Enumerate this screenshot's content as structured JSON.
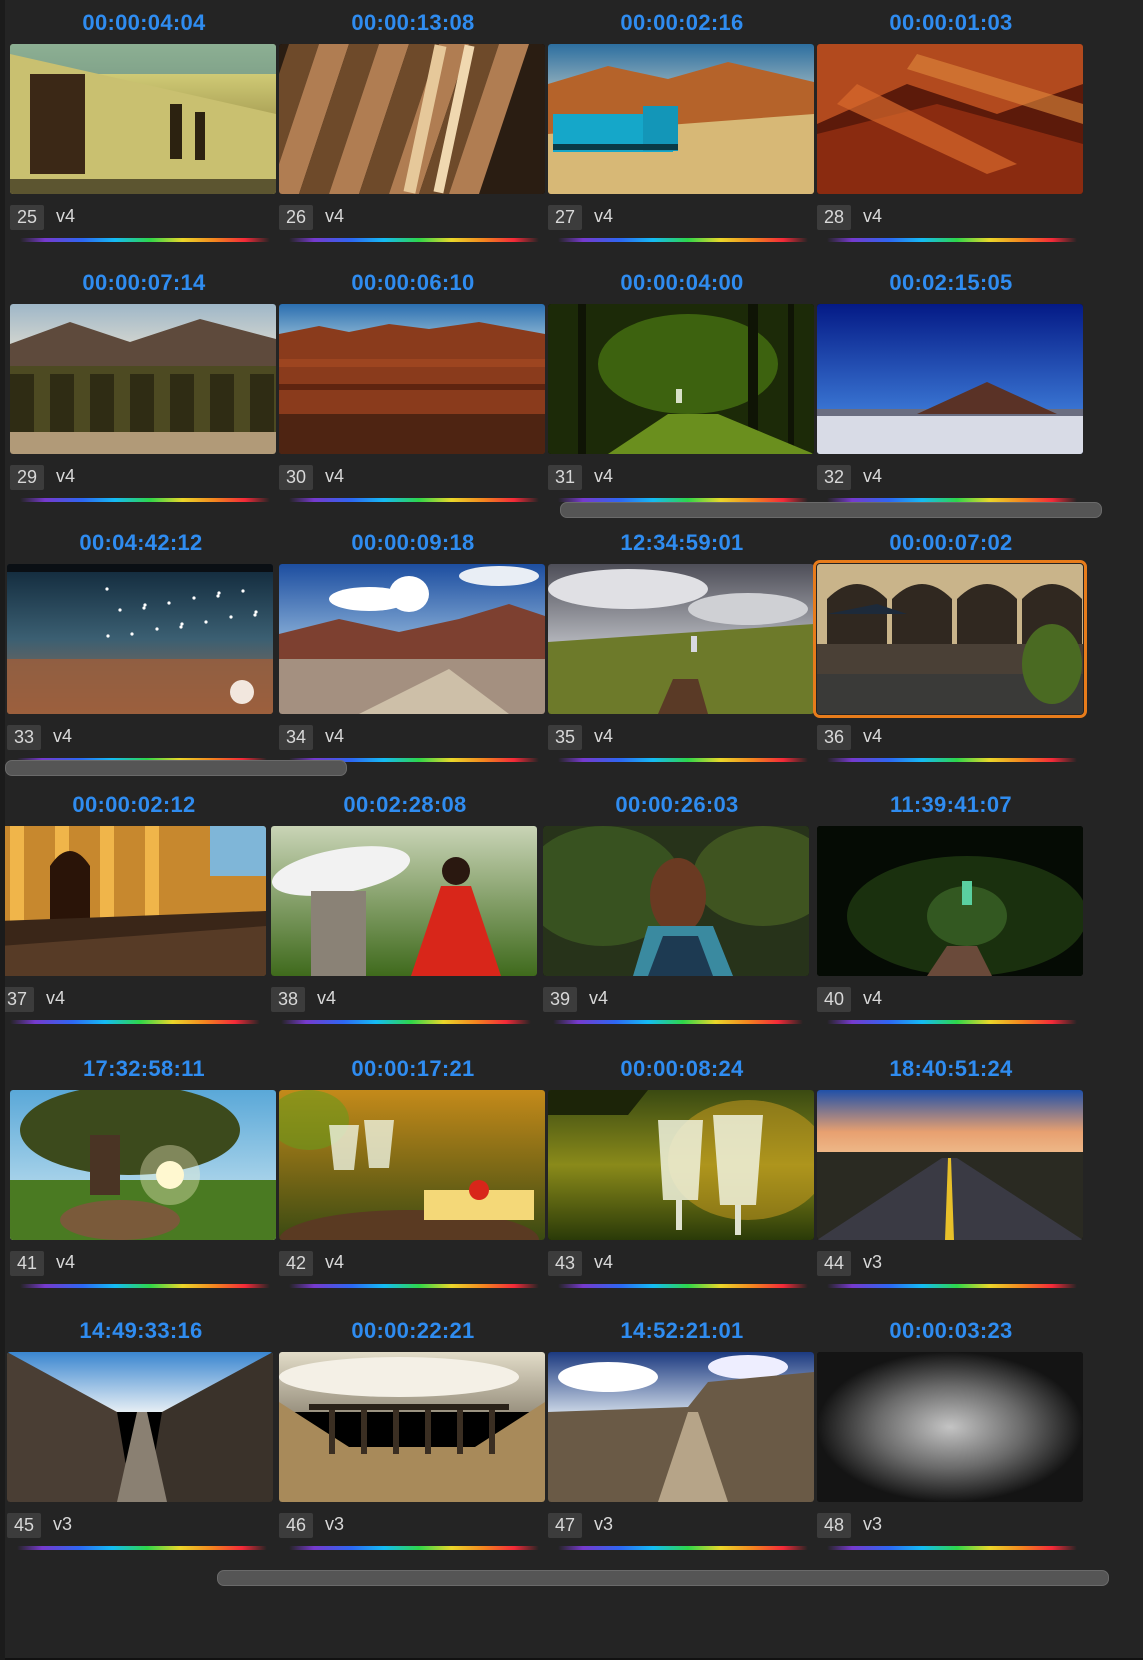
{
  "clips": [
    {
      "timecode": "00:00:04:04",
      "number": "25",
      "version": "v4",
      "scene": "street"
    },
    {
      "timecode": "00:00:13:08",
      "number": "26",
      "version": "v4",
      "scene": "beams"
    },
    {
      "timecode": "00:00:02:16",
      "number": "27",
      "version": "v4",
      "scene": "train"
    },
    {
      "timecode": "00:00:01:03",
      "number": "28",
      "version": "v4",
      "scene": "redrock"
    },
    {
      "timecode": "00:00:07:14",
      "number": "29",
      "version": "v4",
      "scene": "vineyard"
    },
    {
      "timecode": "00:00:06:10",
      "number": "30",
      "version": "v4",
      "scene": "canyon"
    },
    {
      "timecode": "00:00:04:00",
      "number": "31",
      "version": "v4",
      "scene": "forest"
    },
    {
      "timecode": "00:02:15:05",
      "number": "32",
      "version": "v4",
      "scene": "pyramid"
    },
    {
      "timecode": "00:04:42:12",
      "number": "33",
      "version": "v4",
      "scene": "water"
    },
    {
      "timecode": "00:00:09:18",
      "number": "34",
      "version": "v4",
      "scene": "mountains"
    },
    {
      "timecode": "12:34:59:01",
      "number": "35",
      "version": "v4",
      "scene": "horseback"
    },
    {
      "timecode": "00:00:07:02",
      "number": "36",
      "version": "v4",
      "scene": "cafe",
      "selected": true
    },
    {
      "timecode": "00:00:02:12",
      "number": "37",
      "version": "v4",
      "scene": "arches"
    },
    {
      "timecode": "00:02:28:08",
      "number": "38",
      "version": "v4",
      "scene": "dance"
    },
    {
      "timecode": "00:00:26:03",
      "number": "39",
      "version": "v4",
      "scene": "girl"
    },
    {
      "timecode": "11:39:41:07",
      "number": "40",
      "version": "v4",
      "scene": "nightride"
    },
    {
      "timecode": "17:32:58:11",
      "number": "41",
      "version": "v4",
      "scene": "tree"
    },
    {
      "timecode": "00:00:17:21",
      "number": "42",
      "version": "v4",
      "scene": "wineglasses"
    },
    {
      "timecode": "00:00:08:24",
      "number": "43",
      "version": "v4",
      "scene": "pour"
    },
    {
      "timecode": "18:40:51:24",
      "number": "44",
      "version": "v3",
      "scene": "road"
    },
    {
      "timecode": "14:49:33:16",
      "number": "45",
      "version": "v3",
      "scene": "gorge"
    },
    {
      "timecode": "00:00:22:21",
      "number": "46",
      "version": "v3",
      "scene": "bridge"
    },
    {
      "timecode": "14:52:21:01",
      "number": "47",
      "version": "v3",
      "scene": "track"
    },
    {
      "timecode": "00:00:03:23",
      "number": "48",
      "version": "v3",
      "scene": "blur"
    }
  ],
  "colors": {
    "timecode": "#2f8cf0",
    "selection": "#e77c1b",
    "background": "#1b1b1b"
  }
}
